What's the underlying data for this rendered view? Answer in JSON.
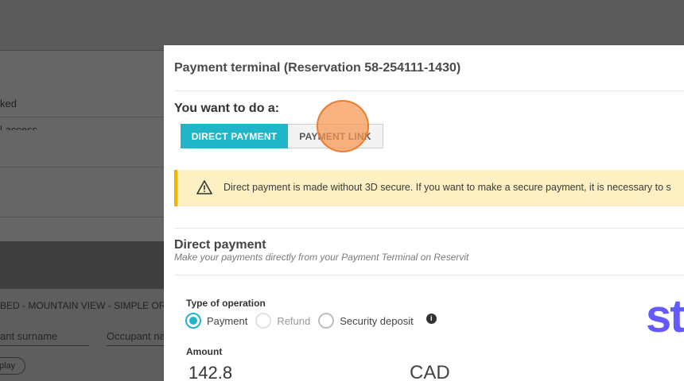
{
  "background": {
    "row1": "ked",
    "row2": "l access",
    "room": "BED - MOUNTAIN VIEW - SIMPLE OR",
    "surname_placeholder": "ant surname",
    "name_placeholder": "Occupant na",
    "pill": "play"
  },
  "modal": {
    "title": "Payment terminal (Reservation 58-254111-1430)",
    "question": "You want to do a:",
    "buttons": {
      "direct": "DIRECT PAYMENT",
      "link": "PAYMENT LINK"
    },
    "alert": {
      "icon": "warning-icon",
      "text": "Direct payment is made without 3D secure. If you want to make a secure payment, it is necessary to s"
    },
    "section": {
      "title": "Direct payment",
      "subtitle": "Make your payments directly from your Payment Terminal on Reservit"
    },
    "operation": {
      "label": "Type of operation",
      "options": [
        "Payment",
        "Refund",
        "Security deposit"
      ],
      "selected": "Payment"
    },
    "amount": {
      "label": "Amount",
      "value": "142.8",
      "currency": "CAD"
    },
    "brand": "st"
  },
  "colors": {
    "accent": "#1fb6c8",
    "warning_bg": "#fdf0c2",
    "warning_border": "#f0b400",
    "brand": "#635bff"
  }
}
